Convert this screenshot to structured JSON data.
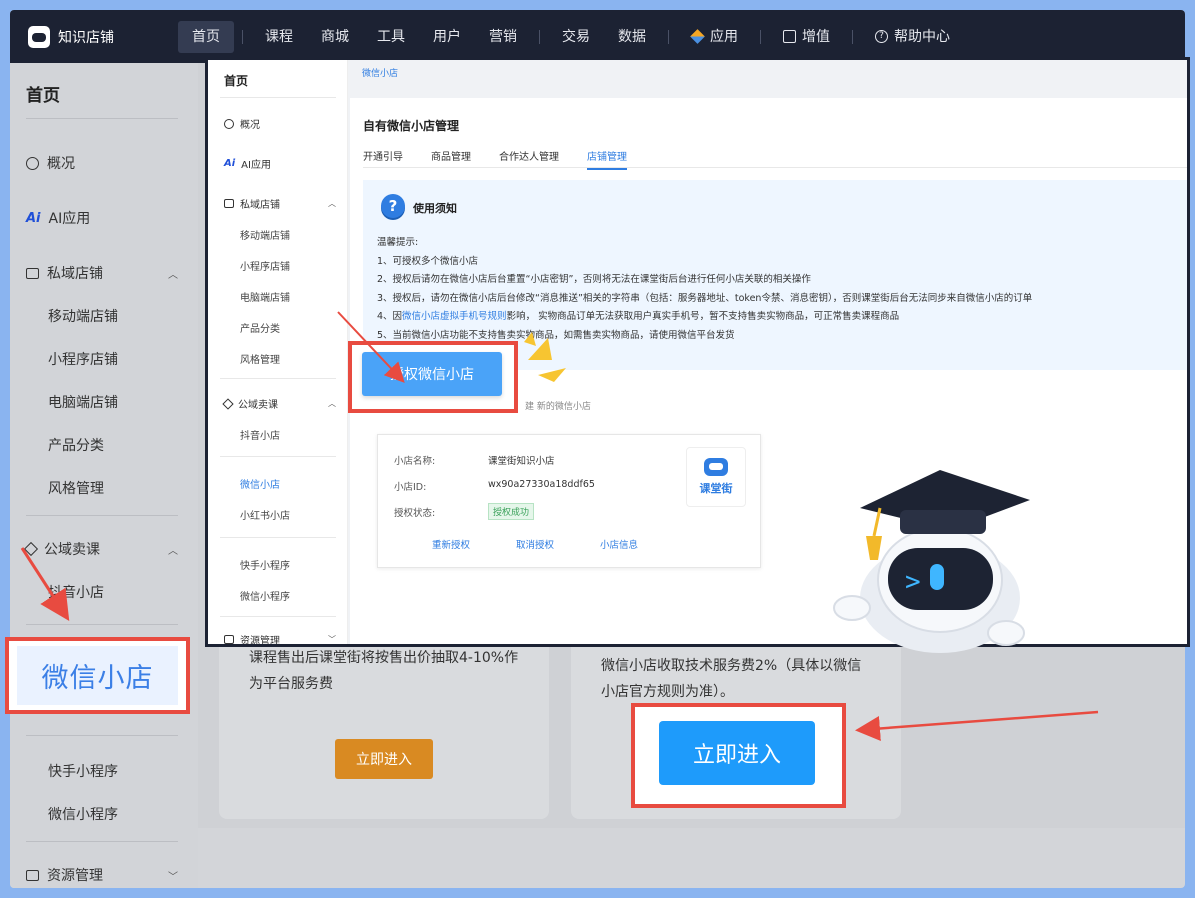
{
  "nav": {
    "logo_text": "知识店铺",
    "items": [
      {
        "label": "首页"
      },
      {
        "label": "课程"
      },
      {
        "label": "商城"
      },
      {
        "label": "工具"
      },
      {
        "label": "用户"
      },
      {
        "label": "营销"
      },
      {
        "label": "交易"
      },
      {
        "label": "数据"
      },
      {
        "label": "应用",
        "icon": "cube-icon"
      },
      {
        "label": "增值",
        "icon": "trend-icon"
      },
      {
        "label": "帮助中心",
        "icon": "help-icon"
      }
    ]
  },
  "sidebar": {
    "title": "首页",
    "overview": "概况",
    "ai_app": "AI应用",
    "ai_glyph": "Ai",
    "private_store": "私域店铺",
    "private_items": [
      "移动端店铺",
      "小程序店铺",
      "电脑端店铺",
      "产品分类",
      "风格管理"
    ],
    "public_course": "公域卖课",
    "public_items": [
      "抖音小店"
    ],
    "highlighted": "微信小店",
    "mini_items": [
      "快手小程序",
      "微信小程序"
    ],
    "resource": "资源管理"
  },
  "cards": {
    "left_text": "课程售出后课堂街将按售出价抽取4-10%作为平台服务费",
    "left_button": "立即进入",
    "right_text": "微信小店收取技术服务费2%（具体以微信小店官方规则为准）。",
    "right_button": "立即进入"
  },
  "overlay": {
    "side": {
      "title": "首页",
      "overview": "概况",
      "ai_app": "AI应用",
      "ai_glyph": "Ai",
      "private_store": "私域店铺",
      "private_items": [
        "移动端店铺",
        "小程序店铺",
        "电脑端店铺",
        "产品分类",
        "风格管理"
      ],
      "public_course": "公域卖课",
      "public_items": [
        "抖音小店"
      ],
      "wx_items": [
        "微信小店",
        "小红书小店"
      ],
      "mini_items": [
        "快手小程序",
        "微信小程序"
      ],
      "resource": "资源管理"
    },
    "breadcrumb": "微信小店",
    "panel_title": "自有微信小店管理",
    "tabs": [
      "开通引导",
      "商品管理",
      "合作达人管理",
      "店铺管理"
    ],
    "active_tab": 3,
    "notice": {
      "title": "使用须知",
      "heading": "温馨提示:",
      "lines": [
        "1、可授权多个微信小店",
        "2、授权后请勿在微信小店后台重置“小店密钥”，否则将无法在课堂街后台进行任何小店关联的相关操作",
        "3、授权后，请勿在微信小店后台修改“消息推送”相关的字符串（包括：服务器地址、token令禁、消息密钥），否则课堂街后台无法同步来自微信小店的订单",
        "4、因微信小店虚拟手机号规则影响， 实物商品订单无法获取用户真实手机号，暂不支持售卖实物商品，可正常售卖课程商品",
        "5、当前微信小店功能不支持售卖实物商品，如需售卖实物商品，请使用微信平台发货"
      ],
      "line4_prefix": "4、因",
      "line4_link": "微信小店虚拟手机号规则",
      "line4_suffix": "影响， 实物商品订单无法获取用户真实手机号，暂不支持售卖实物商品，可正常售卖课程商品"
    },
    "auth_button": "授权微信小店",
    "auth_tip": "建 新的微信小店",
    "shop": {
      "name_label": "小店名称:",
      "name_value": "课堂街知识小店",
      "id_label": "小店ID:",
      "id_value": "wx90a27330a18ddf65",
      "status_label": "授权状态:",
      "status_value": "授权成功",
      "links": [
        "重新授权",
        "取消授权",
        "小店信息"
      ],
      "logo_text": "课堂街"
    }
  },
  "colors": {
    "nav_bg": "#1c2233",
    "accent_blue": "#1e9bfb",
    "highlight_red": "#e84b40",
    "orange_button": "#d98a22"
  }
}
